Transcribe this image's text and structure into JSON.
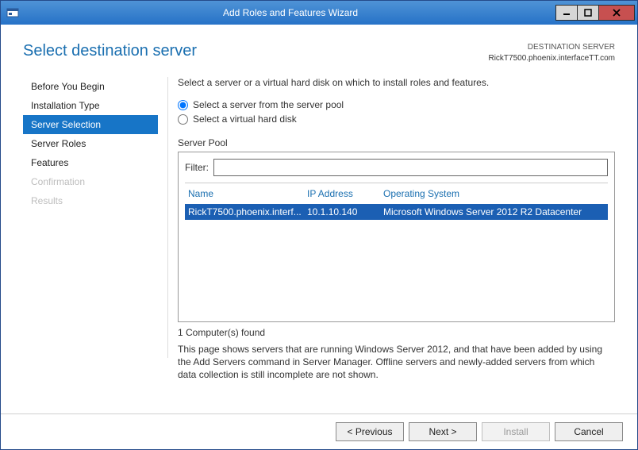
{
  "window": {
    "title": "Add Roles and Features Wizard"
  },
  "header": {
    "page_title": "Select destination server",
    "dest_label": "DESTINATION SERVER",
    "dest_host": "RickT7500.phoenix.interfaceTT.com"
  },
  "sidenav": {
    "items": [
      {
        "label": "Before You Begin",
        "state": "normal"
      },
      {
        "label": "Installation Type",
        "state": "normal"
      },
      {
        "label": "Server Selection",
        "state": "selected"
      },
      {
        "label": "Server Roles",
        "state": "normal"
      },
      {
        "label": "Features",
        "state": "normal"
      },
      {
        "label": "Confirmation",
        "state": "disabled"
      },
      {
        "label": "Results",
        "state": "disabled"
      }
    ]
  },
  "main": {
    "instruction": "Select a server or a virtual hard disk on which to install roles and features.",
    "radio_pool": "Select a server from the server pool",
    "radio_vhd": "Select a virtual hard disk",
    "section_label": "Server Pool",
    "filter_label": "Filter:",
    "filter_value": "",
    "columns": {
      "name": "Name",
      "ip": "IP Address",
      "os": "Operating System"
    },
    "rows": [
      {
        "name": "RickT7500.phoenix.interf...",
        "ip": "10.1.10.140",
        "os": "Microsoft Windows Server 2012 R2 Datacenter"
      }
    ],
    "count_text": "1 Computer(s) found",
    "description": "This page shows servers that are running Windows Server 2012, and that have been added by using the Add Servers command in Server Manager. Offline servers and newly-added servers from which data collection is still incomplete are not shown."
  },
  "footer": {
    "previous": "< Previous",
    "next": "Next >",
    "install": "Install",
    "cancel": "Cancel"
  }
}
